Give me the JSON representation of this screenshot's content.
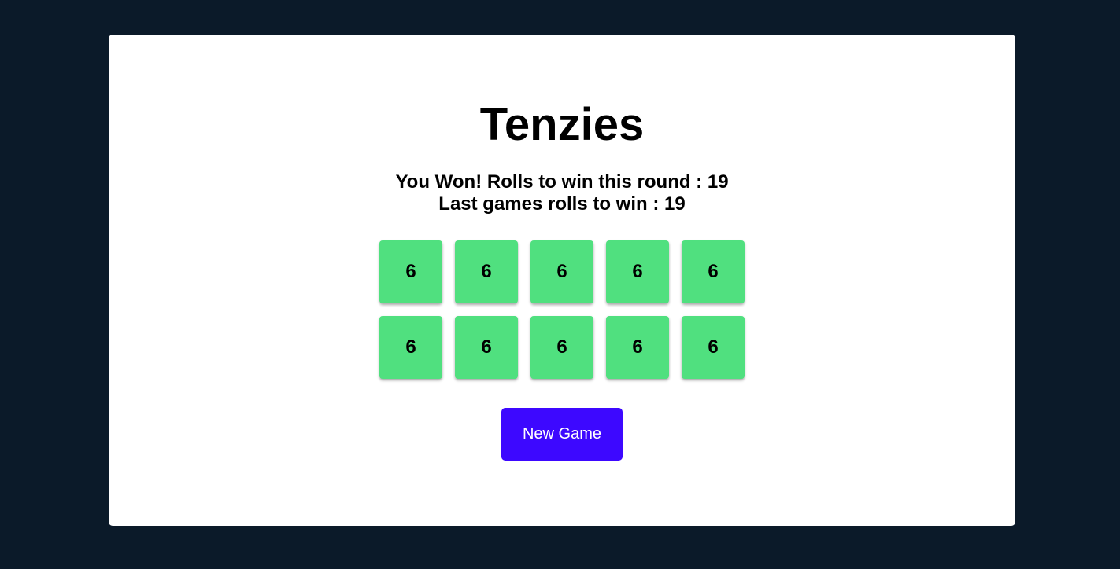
{
  "game": {
    "title": "Tenzies",
    "status_line_1": "You Won! Rolls to win this round : 19",
    "status_line_2": "Last games rolls to win : 19",
    "dice": [
      {
        "value": "6",
        "held": true
      },
      {
        "value": "6",
        "held": true
      },
      {
        "value": "6",
        "held": true
      },
      {
        "value": "6",
        "held": true
      },
      {
        "value": "6",
        "held": true
      },
      {
        "value": "6",
        "held": true
      },
      {
        "value": "6",
        "held": true
      },
      {
        "value": "6",
        "held": true
      },
      {
        "value": "6",
        "held": true
      },
      {
        "value": "6",
        "held": true
      }
    ],
    "new_game_label": "New Game"
  },
  "colors": {
    "page_background": "#0b1a29",
    "board_background": "#ffffff",
    "held_die": "#50e07f",
    "button_background": "#3d08ff",
    "button_text": "#ffffff"
  }
}
